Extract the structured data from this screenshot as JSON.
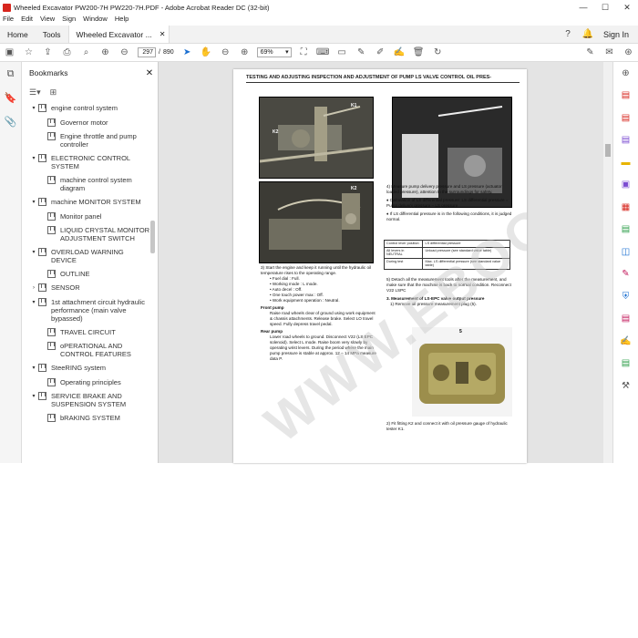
{
  "window": {
    "title": "Wheeled Excavator PW200-7H PW220-7H.PDF - Adobe Acrobat Reader DC (32-bit)",
    "controls": [
      "—",
      "☐",
      "✕"
    ]
  },
  "menu": [
    "File",
    "Edit",
    "View",
    "Sign",
    "Window",
    "Help"
  ],
  "tabs": {
    "home": "Home",
    "tools": "Tools",
    "document": "Wheeled Excavator ...",
    "sign_in": "Sign In"
  },
  "toolbar": {
    "page_current": "297",
    "page_total": "890",
    "zoom": "69%"
  },
  "bookmarks": {
    "title": "Bookmarks",
    "items": [
      {
        "label": "engine control system",
        "level": 1,
        "expanded": true
      },
      {
        "label": "Governor motor",
        "level": 2
      },
      {
        "label": "Engine throttle and pump controller",
        "level": 2
      },
      {
        "label": "ELECTRONIC CONTROL SYSTEM",
        "level": 1,
        "expanded": true
      },
      {
        "label": "machine control system diagram",
        "level": 2
      },
      {
        "label": "machine MONITOR SYSTEM",
        "level": 1,
        "expanded": true
      },
      {
        "label": "Monitor panel",
        "level": 2
      },
      {
        "label": "LIQUID CRYSTAL MONITOR ADJUSTMENT SWITCH",
        "level": 2
      },
      {
        "label": "OVERLOAD WARNING DEVICE",
        "level": 1,
        "expanded": true
      },
      {
        "label": "OUTLINE",
        "level": 2
      },
      {
        "label": "SENSOR",
        "level": 1,
        "expanded": false
      },
      {
        "label": "1st attachment circuit hydraulic performance (main valve bypassed)",
        "level": 1,
        "expanded": true
      },
      {
        "label": "TRAVEL CIRCUIT",
        "level": 2
      },
      {
        "label": "oPERATIONAL AND CONTROL FEATURES",
        "level": 2
      },
      {
        "label": "SteeRING system",
        "level": 1,
        "expanded": true
      },
      {
        "label": "Operating principles",
        "level": 2
      },
      {
        "label": "SERVICE BRAKE AND SUSPENSION SYSTEM",
        "level": 1,
        "expanded": true
      },
      {
        "label": "bRAKING SYSTEM",
        "level": 2
      }
    ]
  },
  "document": {
    "header": "TESTING AND ADJUSTING    INSPECTION AND ADJUSTMENT OF PUMP LS VALVE CONTROL OIL PRES-",
    "watermark": "WWW.EBOOK.COM",
    "photo_labels": [
      "K1",
      "K2",
      "K2",
      "5"
    ],
    "left_text": [
      "3)  Start the engine and keep it running until the hydraulic oil temperature rises to the operating range.",
      "• Fuel dial : Full.",
      "• Working mode : L mode.",
      "• Auto decel : Off.",
      "• One touch power max : Off.",
      "• Work equipment operation : Neutral."
    ],
    "front_pump_title": "Front pump",
    "front_pump_text": "Raise road wheels clear of ground using work equipment & chassis attachments. Release brake. Select LO travel speed. Fully depress travel pedal.",
    "rear_pump_title": "Rear pump",
    "rear_pump_text": "Lower road wheels to ground. Disconnect V22 (LS EPC solenoid). Select L mode. Raise boom very slowly by operating wrist levers. During the period where the main pump pressure is stable at approx. 12 – 14 MPa measure data P.",
    "right_text": [
      "4)  Measure pump delivery pressure and LS pressure (actuator loaded pressure), attention to the surroundings for safety.",
      "♦  Calculation of LS differential pressure: LS differential pressure = Pump delivery pressure – LS pressure",
      "♦  If LS differential pressure is in the following conditions, it is judged normal."
    ],
    "table": [
      [
        "Control lever position",
        "LS differential pressure"
      ],
      [
        "All levers in NEUTRAL",
        "Unload pressure (see standard value table)"
      ],
      [
        "During test",
        "Max. LS differential pressure (see standard value table)"
      ]
    ],
    "right_text_2": [
      "5)  Detach all the measurement tools after the measurement, and make sure that the machine is back to normal condition. Reconnect V22 LSPC",
      "3.  Measurement of LS-EPC valve output pressure",
      "1)  Remove oil pressure measurement plug (5).",
      "2)  Fit fitting K2 and connect it with oil pressure gauge of hydraulic tester K1."
    ]
  }
}
